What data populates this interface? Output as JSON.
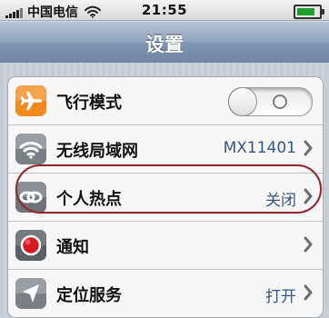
{
  "status_bar": {
    "carrier": "中国电信",
    "time": "21:55",
    "signal_bars": 4,
    "battery_level": 0.82
  },
  "nav": {
    "title": "设置"
  },
  "rows": [
    {
      "label": "飞行模式",
      "icon": "airplane-icon",
      "control": "toggle",
      "toggle_on": false
    },
    {
      "label": "无线局域网",
      "icon": "wifi-icon",
      "value": "MX11401"
    },
    {
      "label": "个人热点",
      "icon": "personal-hotspot-icon",
      "value": "关闭",
      "highlighted": true
    },
    {
      "label": "通知",
      "icon": "notifications-icon"
    },
    {
      "label": "定位服务",
      "icon": "location-icon",
      "value": "打开"
    }
  ],
  "colors": {
    "nav_blue": "#7f95b1",
    "detail_text": "#385487",
    "highlight": "#8c2a2d",
    "airplane_orange": "#f28a1f",
    "notification_red": "#d71921"
  }
}
